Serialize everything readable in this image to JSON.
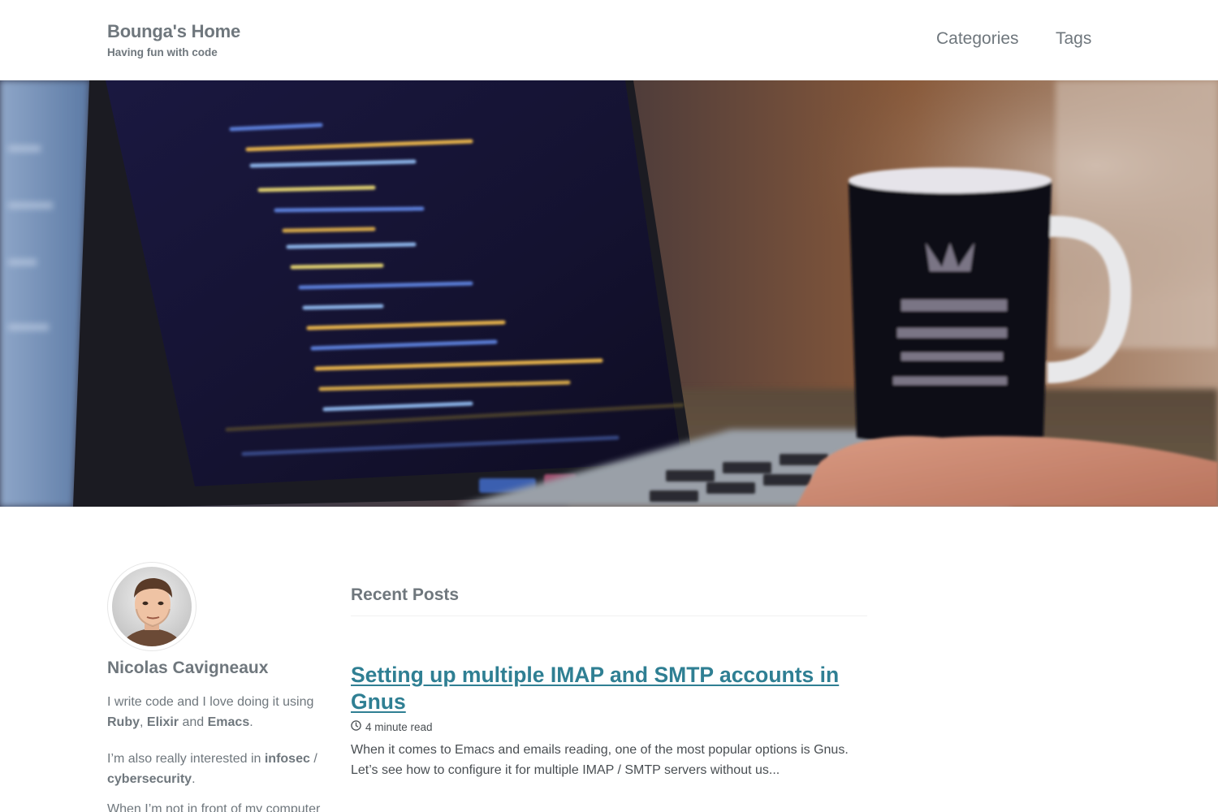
{
  "masthead": {
    "site_title": "Bounga's Home",
    "site_subtitle": "Having fun with code",
    "nav": [
      {
        "label": "Categories"
      },
      {
        "label": "Tags"
      }
    ]
  },
  "hero": {
    "image_alt": "laptop with code and coffee mug"
  },
  "author": {
    "name": "Nicolas Cavigneaux",
    "bio1_prefix": "I write code and I love doing it using ",
    "bio1_ruby": "Ruby",
    "bio1_sep": ", ",
    "bio1_elixir": "Elixir",
    "bio1_and": " and ",
    "bio1_emacs": "Emacs",
    "bio1_end": ".",
    "bio2_prefix": "I’m also really interested in ",
    "bio2_infosec": "infosec",
    "bio2_slash": " / ",
    "bio2_cyber": "cybersecurity",
    "bio2_end": ".",
    "bio3_partial": "When I’m not in front of my computer"
  },
  "main": {
    "recent_heading": "Recent Posts",
    "posts": [
      {
        "title": "Setting up multiple IMAP and SMTP accounts in Gnus",
        "read_time": "4 minute read",
        "excerpt": "When it comes to Emacs and emails reading, one of the most popular options is Gnus. Let’s see how to configure it for multiple IMAP / SMTP servers without us..."
      }
    ]
  },
  "colors": {
    "link": "#2f7f93",
    "muted": "#6f777d",
    "text": "#494e52"
  }
}
